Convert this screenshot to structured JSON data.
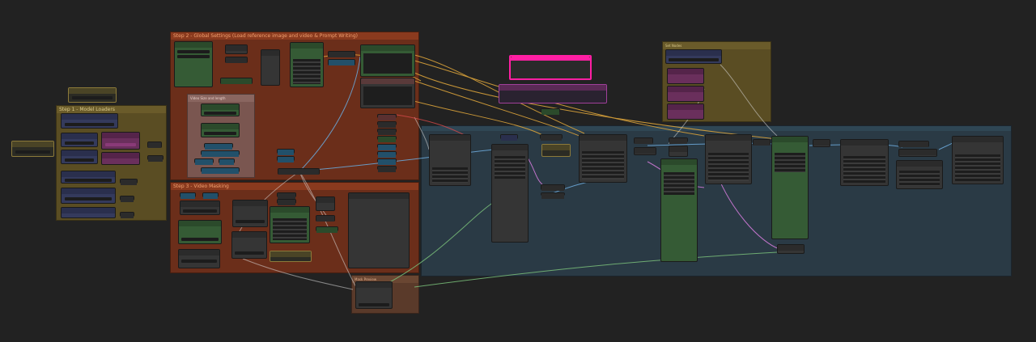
{
  "canvas": {
    "background": "#222222"
  },
  "groups": {
    "step1": {
      "title": "Step 1 - Model Loaders",
      "color": "#5a4d23"
    },
    "step2": {
      "title": "Step 2 - Global Settings (Load reference image and video & Prompt Writing)",
      "color": "#6b2e1a"
    },
    "step3": {
      "title": "Step 3 - Video Masking",
      "color": "#6b2e1a"
    },
    "mask_preview": {
      "title": "Mask Preview",
      "color": "#5a3a2a"
    },
    "sampling": {
      "title": "",
      "color": "#2a3a45"
    },
    "notes": {
      "title": "Set Nodes",
      "color": "#5a4d23"
    },
    "video_size": {
      "title": "Video Size and length",
      "color": "#7a5650"
    }
  },
  "colors": {
    "wire_orange": "#d9a23a",
    "wire_blue": "#6aa6d6",
    "wire_pink": "#d07ad8",
    "wire_green": "#7ac07a",
    "wire_white": "#d8d8d8",
    "wire_red": "#d84a4a",
    "highlight_pink": "#ff1fa3"
  }
}
